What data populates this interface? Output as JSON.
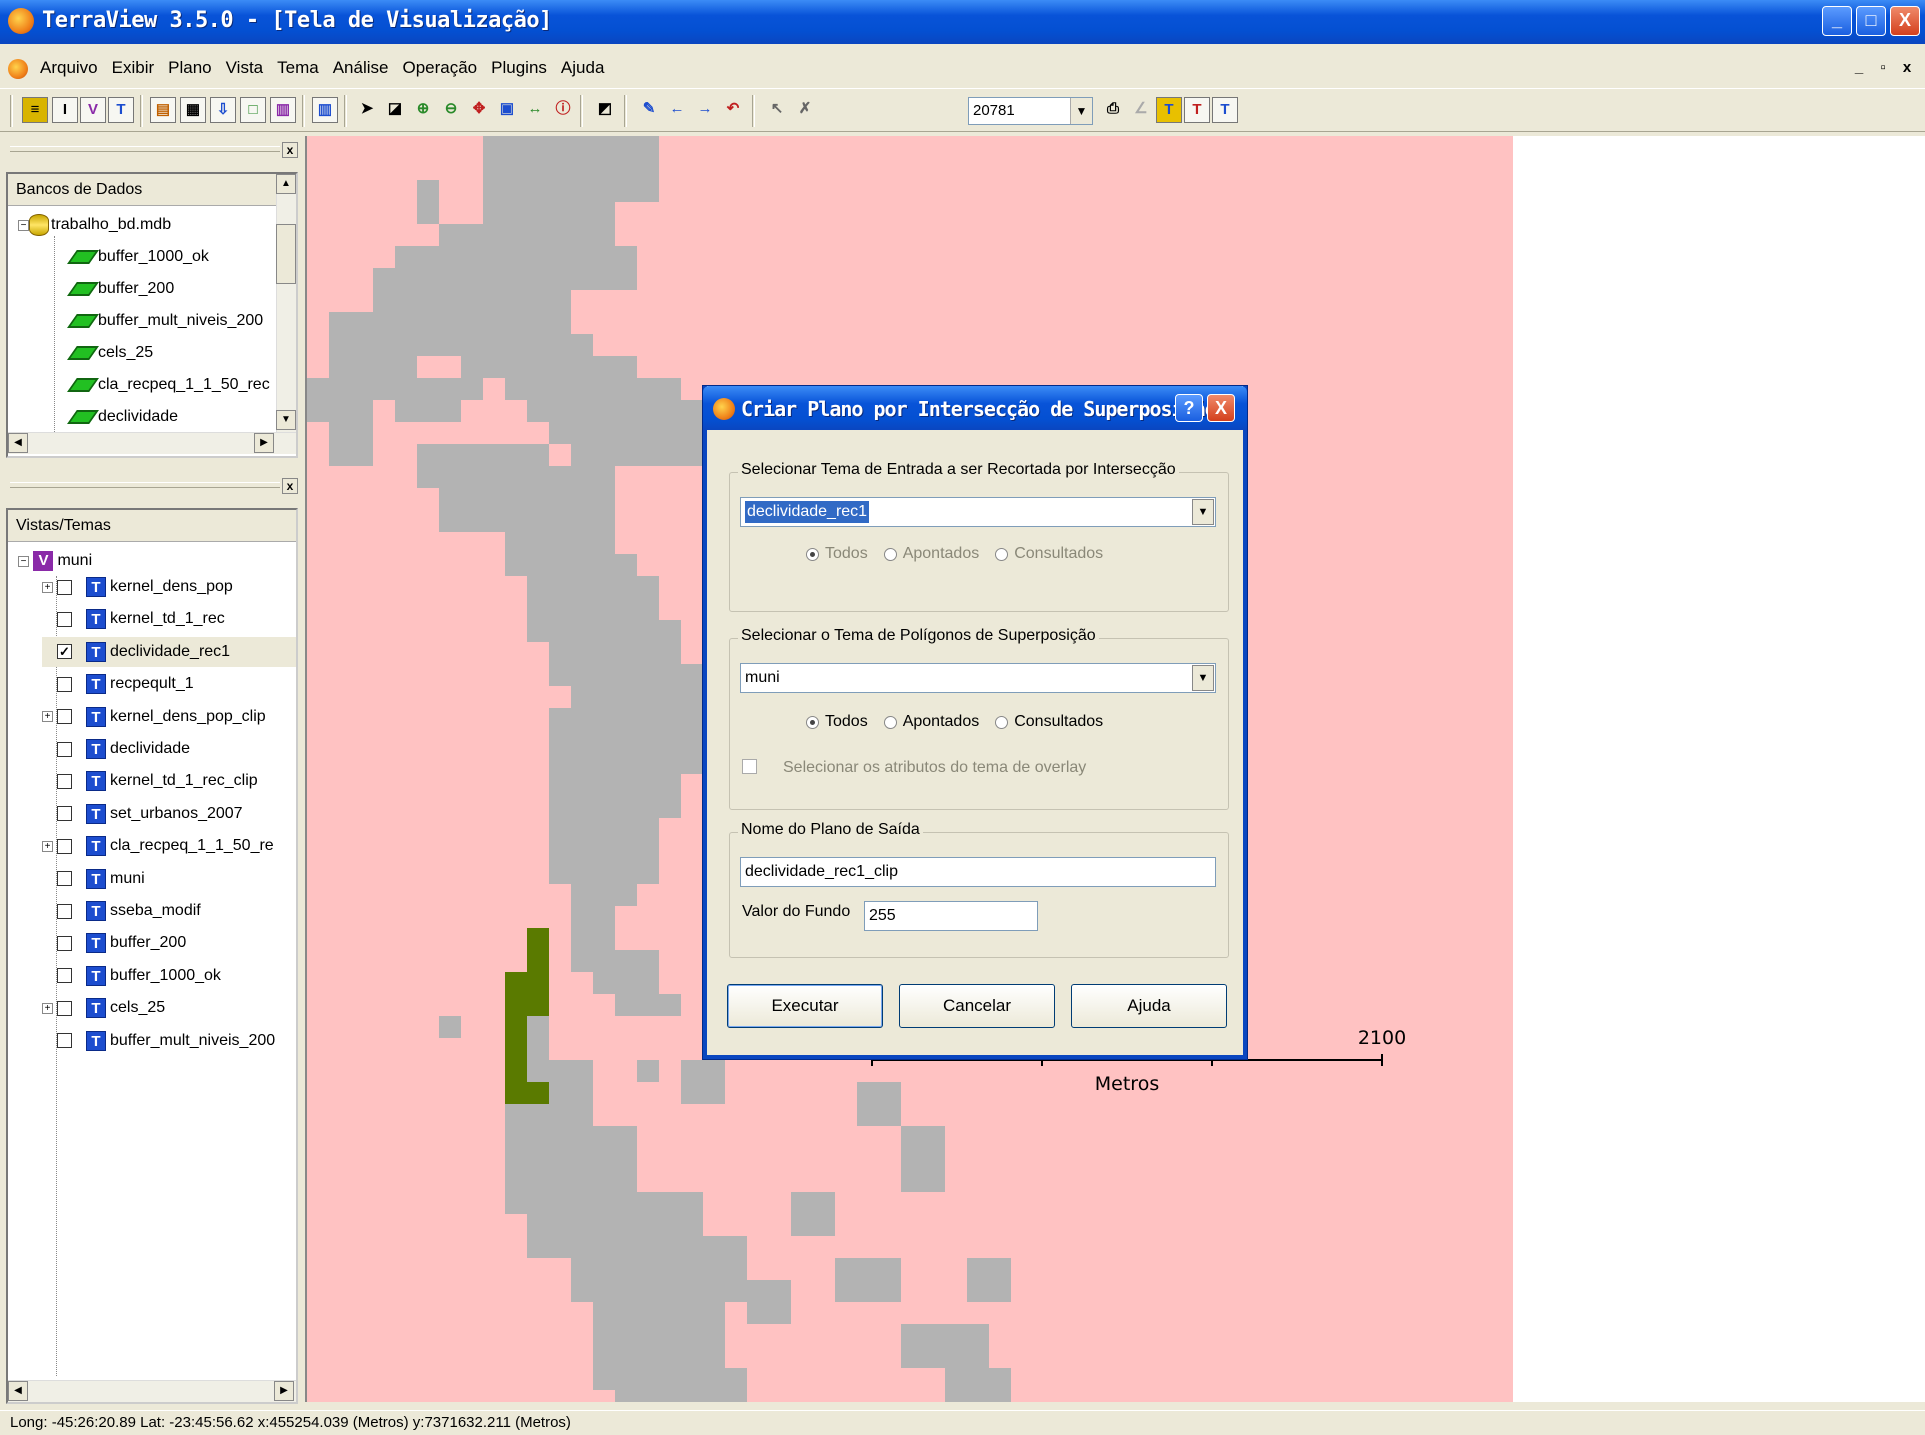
{
  "window": {
    "title": "TerraView 3.5.0 - [Tela de Visualização]",
    "controls": {
      "minimize": "_",
      "maximize": "□",
      "close": "X"
    }
  },
  "menu": {
    "items": [
      "Arquivo",
      "Exibir",
      "Plano",
      "Vista",
      "Tema",
      "Análise",
      "Operação",
      "Plugins",
      "Ajuda"
    ],
    "mdi_controls": [
      "_",
      "▫",
      "x"
    ]
  },
  "toolbar": {
    "scale_value": "20781"
  },
  "databases_panel": {
    "header": "Bancos de Dados",
    "database": "trabalho_bd.mdb",
    "layers": [
      "buffer_1000_ok",
      "buffer_200",
      "buffer_mult_niveis_200",
      "cels_25",
      "cla_recpeq_1_1_50_rec",
      "declividade"
    ]
  },
  "views_panel": {
    "header": "Vistas/Temas",
    "view": "muni",
    "themes": [
      {
        "name": "kernel_dens_pop",
        "checked": false,
        "expandable": true
      },
      {
        "name": "kernel_td_1_rec",
        "checked": false,
        "expandable": false
      },
      {
        "name": "declividade_rec1",
        "checked": true,
        "expandable": false
      },
      {
        "name": "recpeqult_1",
        "checked": false,
        "expandable": false
      },
      {
        "name": "kernel_dens_pop_clip",
        "checked": false,
        "expandable": true
      },
      {
        "name": "declividade",
        "checked": false,
        "expandable": false
      },
      {
        "name": "kernel_td_1_rec_clip",
        "checked": false,
        "expandable": false
      },
      {
        "name": "set_urbanos_2007",
        "checked": false,
        "expandable": false
      },
      {
        "name": "cla_recpeq_1_1_50_re",
        "checked": false,
        "expandable": true
      },
      {
        "name": "muni",
        "checked": false,
        "expandable": false
      },
      {
        "name": "sseba_modif",
        "checked": false,
        "expandable": false
      },
      {
        "name": "buffer_200",
        "checked": false,
        "expandable": false
      },
      {
        "name": "buffer_1000_ok",
        "checked": false,
        "expandable": false
      },
      {
        "name": "cels_25",
        "checked": false,
        "expandable": true
      },
      {
        "name": "buffer_mult_niveis_200",
        "checked": false,
        "expandable": false
      }
    ]
  },
  "map": {
    "scalebar_value": "2100",
    "scalebar_unit": "Metros",
    "colors": {
      "background": "#ffc2c2",
      "gray": "#b3b3b3",
      "green": "#5a7a00",
      "outside": "#ffffff"
    }
  },
  "dialog": {
    "title": "Criar Plano por Intersecção de Superposição",
    "help_button": "?",
    "close_button": "X",
    "group1_label": "Selecionar Tema de Entrada a ser Recortada por Intersecção",
    "input_theme": "declividade_rec1",
    "group2_label": "Selecionar o Tema de Polígonos de Superposição",
    "overlay_theme": "muni",
    "radio_options": [
      "Todos",
      "Apontados",
      "Consultados"
    ],
    "overlay_attrs_label": "Selecionar os atributos do tema de overlay",
    "group3_label": "Nome do Plano de Saída",
    "output_name": "declividade_rec1_clip",
    "background_label": "Valor do Fundo",
    "background_value": "255",
    "buttons": {
      "execute": "Executar",
      "cancel": "Cancelar",
      "help": "Ajuda"
    }
  },
  "status": {
    "text": "Long: -45:26:20.89 Lat: -23:45:56.62  x:455254.039 (Metros)  y:7371632.211 (Metros)"
  }
}
